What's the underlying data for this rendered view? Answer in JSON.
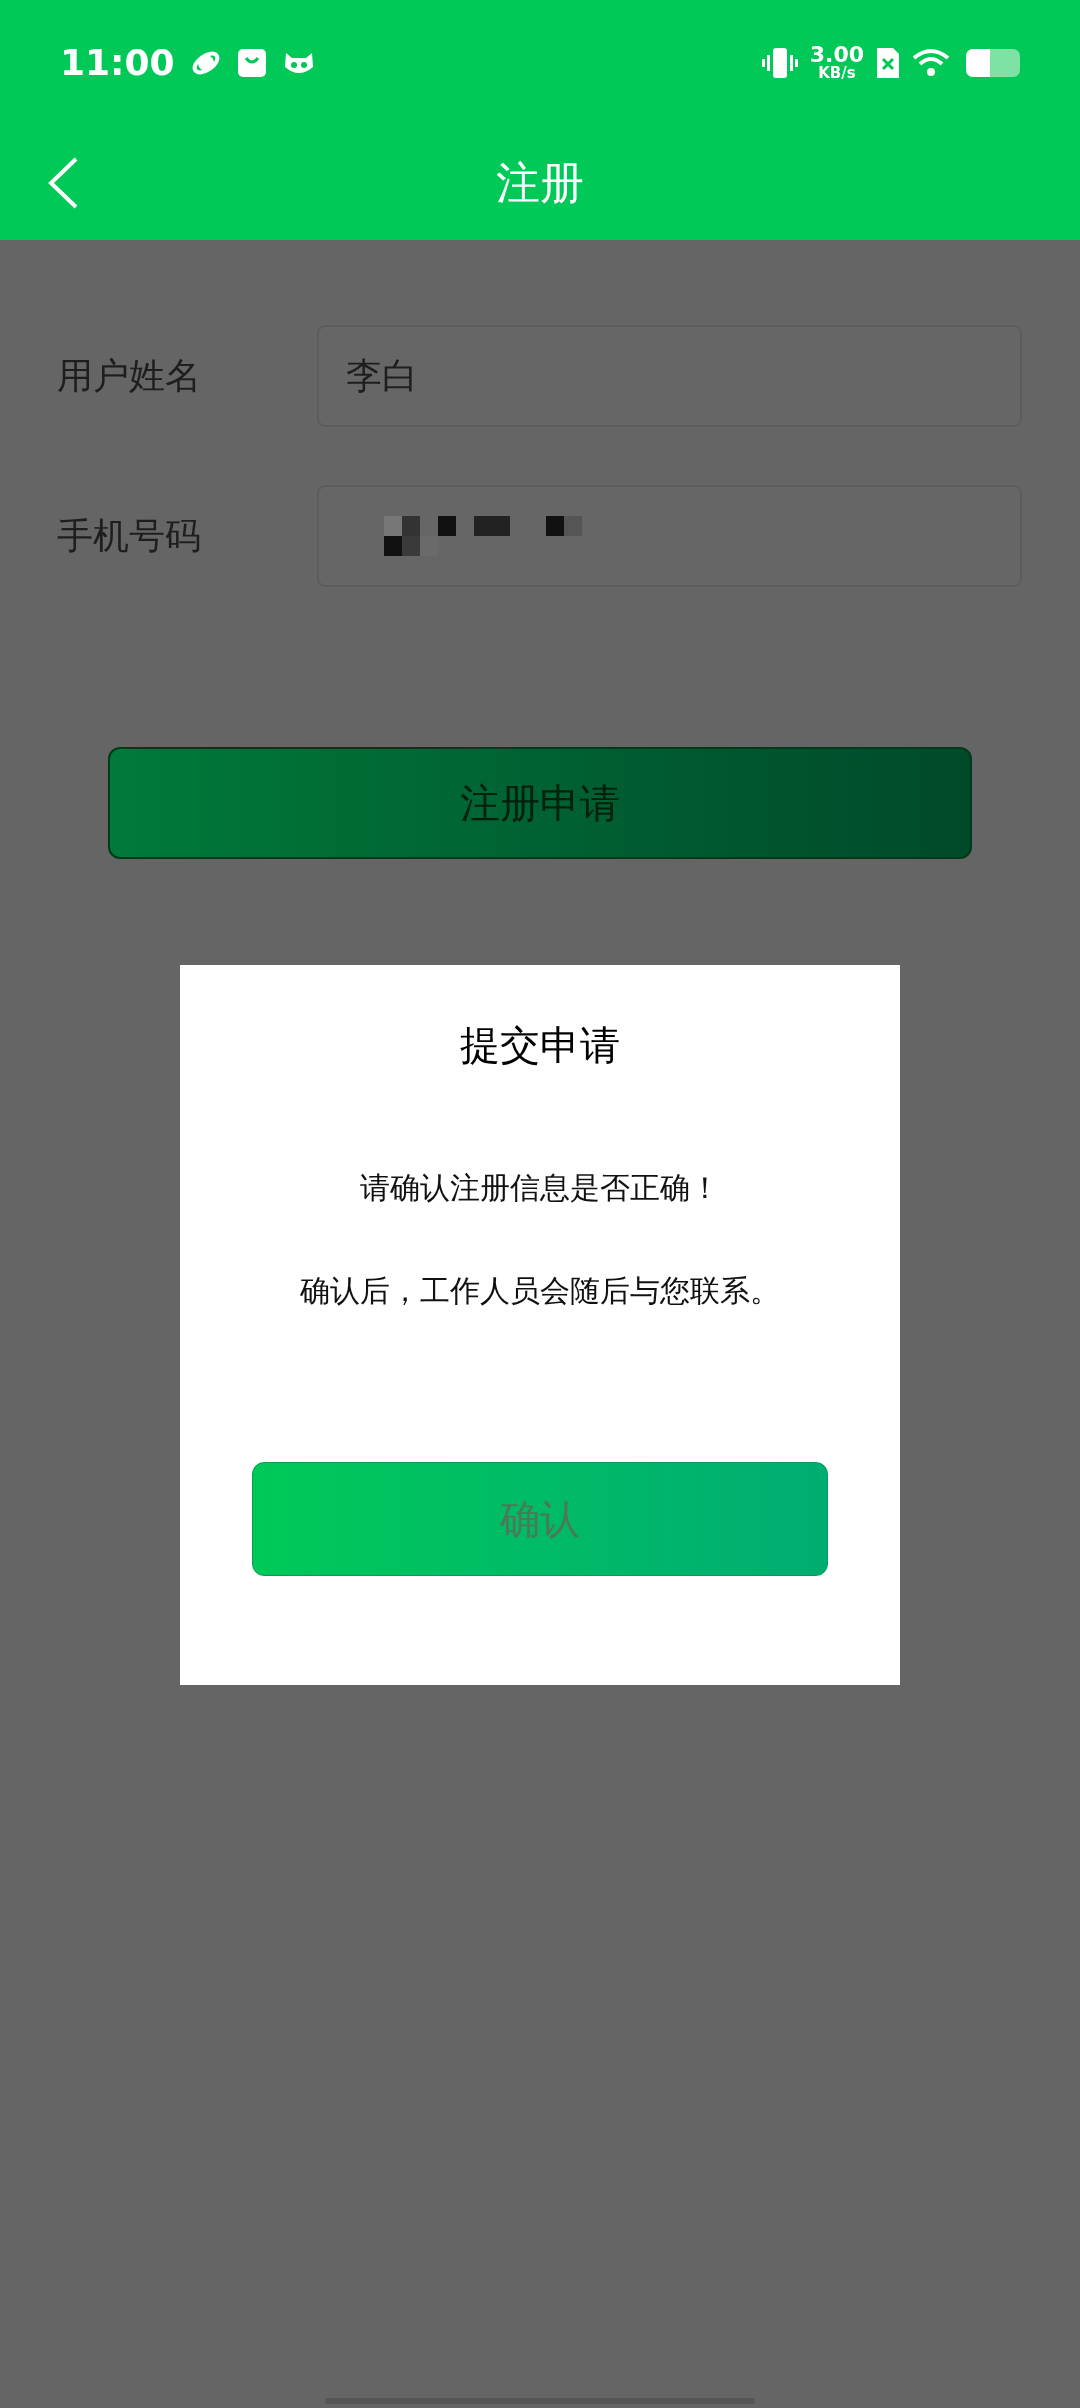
{
  "status_bar": {
    "time": "11:00",
    "net_speed": "3.00",
    "net_unit": "KB/s",
    "battery": {
      "level": 0.45
    }
  },
  "header": {
    "title": "注册"
  },
  "form": {
    "fields": [
      {
        "label": "用户姓名",
        "value": "李白",
        "redacted": false
      },
      {
        "label": "手机号码",
        "redacted": true
      }
    ],
    "submit": "注册申请"
  },
  "dialog": {
    "title": "提交申请",
    "lines": [
      "请确认注册信息是否正确！",
      "确认后，工作人员会随后与您联系。"
    ],
    "button": "确认"
  }
}
